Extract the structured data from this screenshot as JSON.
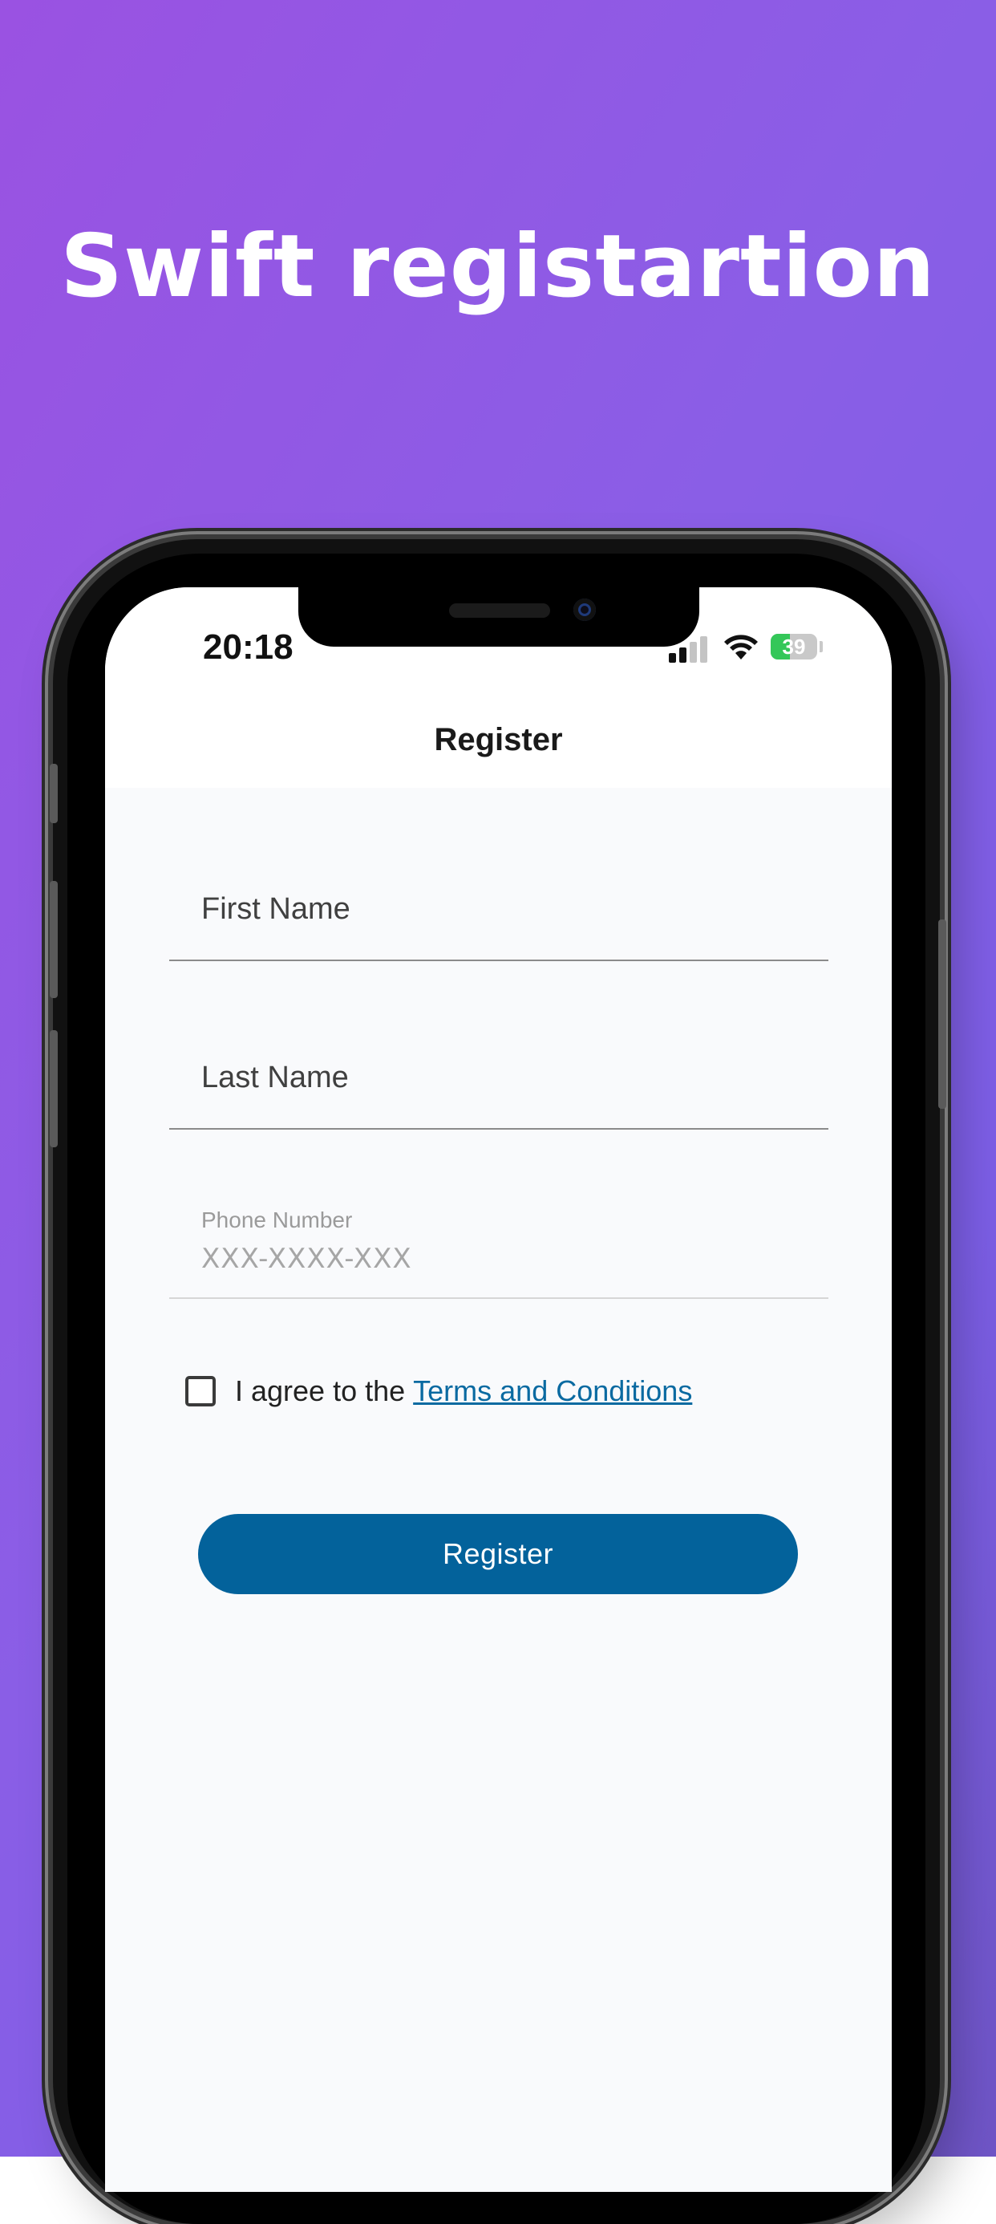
{
  "headline": "Swift registartion",
  "status_bar": {
    "time": "20:18",
    "battery": "39"
  },
  "nav": {
    "title": "Register"
  },
  "form": {
    "first_name_label": "First Name",
    "last_name_label": "Last Name",
    "phone_label": "Phone Number",
    "phone_placeholder": "XXX-XXXX-XXX",
    "terms_prefix": "I agree to the",
    "terms_link": "Terms and Conditions",
    "terms_checked": false,
    "submit_label": "Register"
  },
  "colors": {
    "background_gradient_start": "#9a52e2",
    "background_gradient_end": "#6f55c6",
    "button": "#03629b",
    "link": "#0a6aa1",
    "screen_background": "#f9fafc"
  }
}
